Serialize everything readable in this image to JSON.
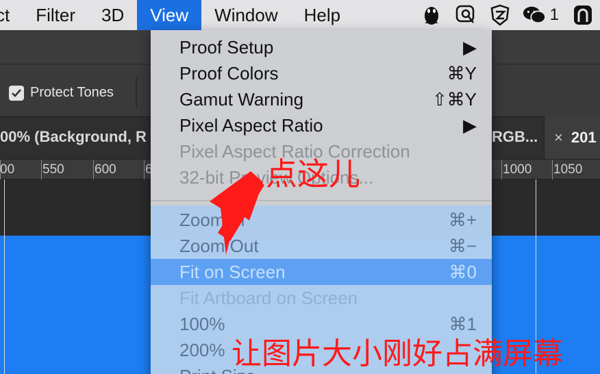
{
  "menubar": {
    "items": [
      "ct",
      "Filter",
      "3D",
      "View",
      "Window",
      "Help"
    ],
    "tray_count": "1"
  },
  "options_bar": {
    "protect_tones_label": "Protect Tones"
  },
  "tabs": {
    "left_label": "00% (Background, R",
    "middle_label": "RGB...",
    "close_glyph": "×",
    "right_label": "201"
  },
  "ruler": {
    "labels": [
      "00",
      "550",
      "600",
      "6",
      "1000",
      "1050"
    ]
  },
  "view_menu": {
    "items": [
      {
        "label": "Proof Setup",
        "shortcut": "▶",
        "enabled": true
      },
      {
        "label": "Proof Colors",
        "shortcut": "⌘Y",
        "enabled": true
      },
      {
        "label": "Gamut Warning",
        "shortcut": "⇧⌘Y",
        "enabled": true
      },
      {
        "label": "Pixel Aspect Ratio",
        "shortcut": "▶",
        "enabled": true
      },
      {
        "label": "Pixel Aspect Ratio Correction",
        "shortcut": "",
        "enabled": false
      },
      {
        "label": "32-bit Preview Options...",
        "shortcut": "",
        "enabled": false
      },
      {
        "label": "Zoom In",
        "shortcut": "⌘+",
        "enabled": true
      },
      {
        "label": "Zoom Out",
        "shortcut": "⌘−",
        "enabled": true
      },
      {
        "label": "Fit on Screen",
        "shortcut": "⌘0",
        "enabled": true,
        "highlighted": true
      },
      {
        "label": "Fit Artboard on Screen",
        "shortcut": "",
        "enabled": false
      },
      {
        "label": "100%",
        "shortcut": "⌘1",
        "enabled": true
      },
      {
        "label": "200%",
        "shortcut": "",
        "enabled": true
      },
      {
        "label": "Print Size",
        "shortcut": "",
        "enabled": true
      }
    ]
  },
  "annotations": {
    "top": "点这儿",
    "bottom": "让图片大小刚好占满屏幕",
    "color": "#ff1a1a"
  },
  "colors": {
    "accent": "#1b6fe0",
    "canvas": "#1c7ef2"
  }
}
